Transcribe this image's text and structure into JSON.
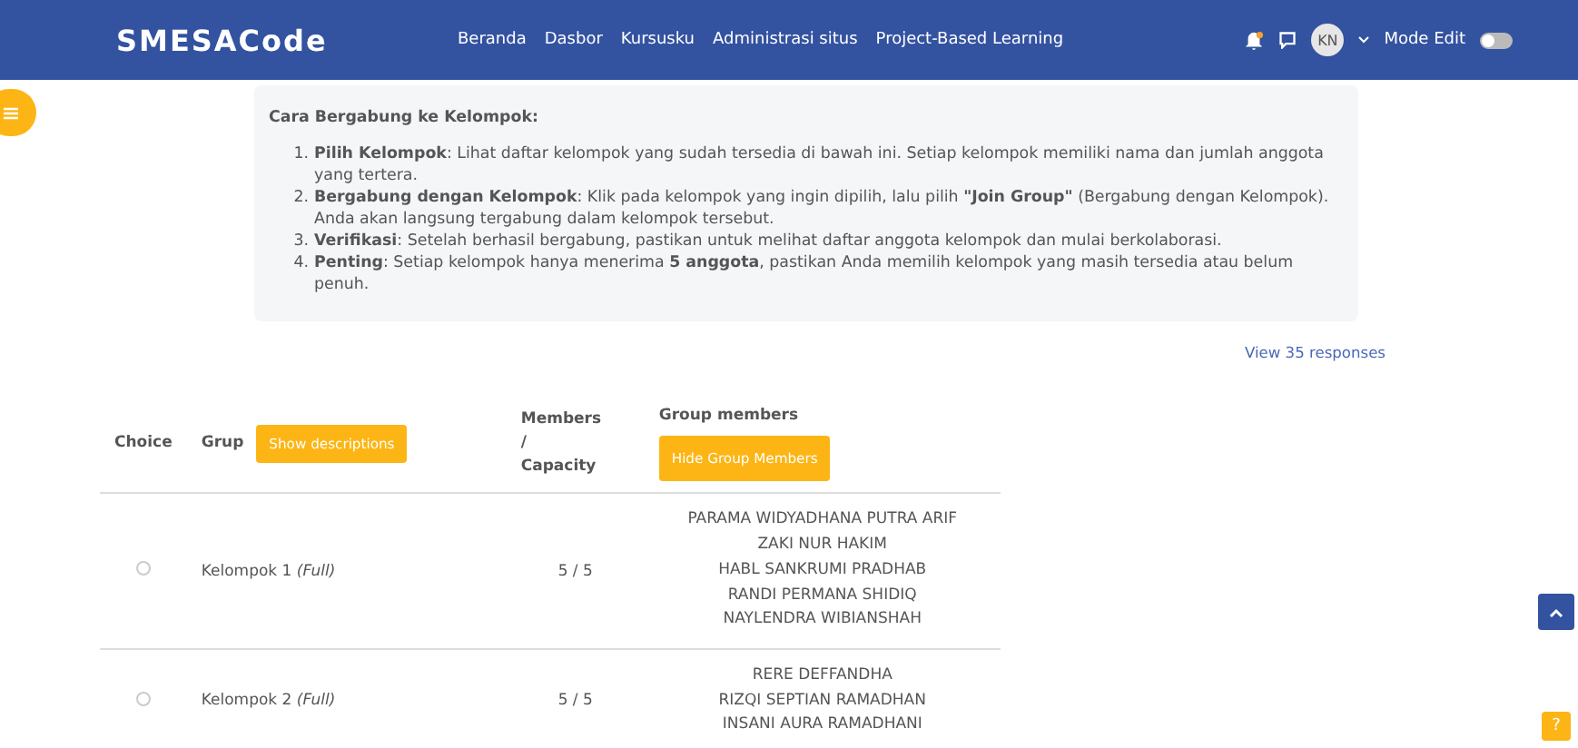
{
  "navbar": {
    "brand": "SMESACode",
    "links": [
      "Beranda",
      "Dasbor",
      "Kursusku",
      "Administrasi situs",
      "Project-Based Learning"
    ],
    "avatar": "KN",
    "mode_edit": {
      "label": "Mode Edit",
      "on": false
    }
  },
  "instructions": {
    "title": "Cara Bergabung ke Kelompok:",
    "steps": [
      {
        "marker": "1.",
        "text": "**Pilih Kelompok**: Lihat daftar kelompok yang sudah tersedia di bawah ini. Setiap kelompok memiliki nama dan jumlah anggota yang tertera."
      },
      {
        "marker": "2.",
        "text": "**Bergabung dengan Kelompok**: Klik pada kelompok yang ingin dipilih, lalu pilih **\"Join Group\"** (Bergabung dengan Kelompok). Anda akan langsung tergabung dalam kelompok tersebut."
      },
      {
        "marker": "3.",
        "text": "**Verifikasi**: Setelah berhasil bergabung, pastikan untuk melihat daftar anggota kelompok dan mulai berkolaborasi."
      },
      {
        "marker": "4.",
        "text": "**Penting**: Setiap kelompok hanya menerima **5 anggota**, pastikan Anda memilih kelompok yang masih tersedia atau belum penuh."
      }
    ]
  },
  "responses_link": "View 35 responses",
  "table": {
    "columns": {
      "choice": "Choice",
      "group": "Grup",
      "group_button": "Show descriptions",
      "members": [
        "Members",
        "/",
        "Capacity"
      ],
      "group_members": "Group members",
      "members_button": "Hide Group Members"
    },
    "rows": [
      {
        "selected": false,
        "name": "Kelompok 1 *(Full)*",
        "count": "5 / 5",
        "members": [
          "PARAMA WIDYADHANA PUTRA ARIF",
          "ZAKI NUR HAKIM",
          "HABL SANKRUMI PRADHAB",
          "RANDI PERMANA SHIDIQ",
          "NAYLENDRA WIBIANSHAH"
        ]
      },
      {
        "selected": false,
        "name": "Kelompok 2 *(Full)*",
        "count": "5 / 5",
        "members": [
          "RERE DEFFANDHA",
          "RIZQI SEPTIAN RAMADHAN",
          "INSANI AURA RAMADHANI"
        ]
      }
    ]
  },
  "help_button": "?"
}
